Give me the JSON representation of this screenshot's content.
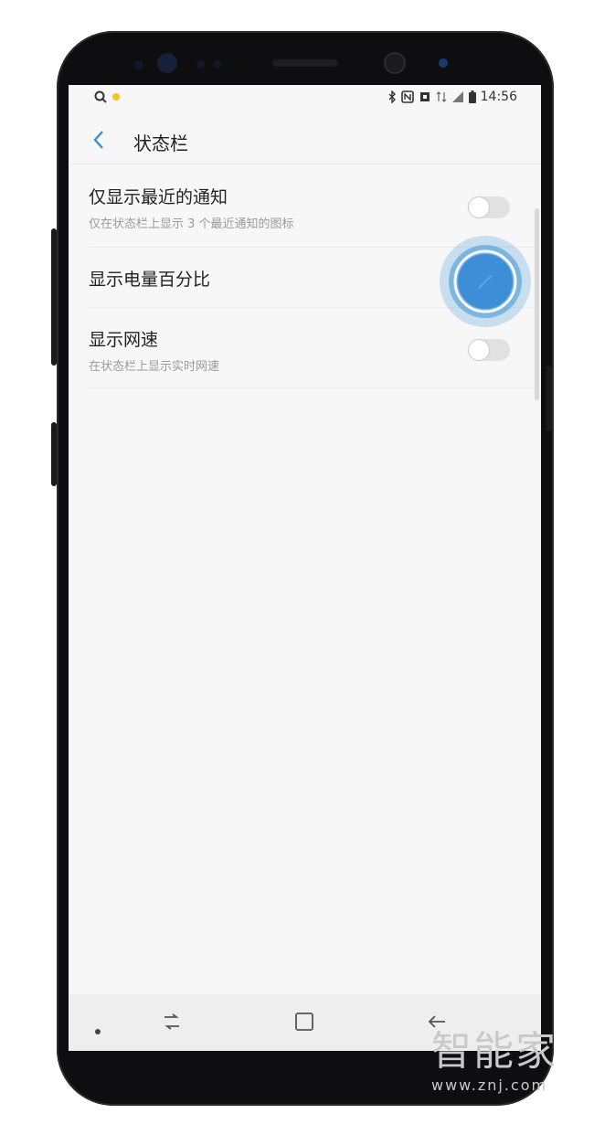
{
  "status_bar": {
    "time": "14:56",
    "left_icons": [
      "search-icon",
      "notification-dot-icon"
    ],
    "right_icons": [
      "bluetooth-icon",
      "nfc-icon",
      "vibrate-icon",
      "data-icon",
      "signal-icon",
      "battery-icon"
    ]
  },
  "header": {
    "back_icon": "chevron-left-icon",
    "title": "状态栏"
  },
  "settings": [
    {
      "title": "仅显示最近的通知",
      "subtitle": "仅在状态栏上显示 3 个最近通知的图标",
      "toggle_on": false
    },
    {
      "title": "显示电量百分比",
      "subtitle": "",
      "toggle_on": true
    },
    {
      "title": "显示网速",
      "subtitle": "在状态栏上显示实时网速",
      "toggle_on": false
    }
  ],
  "nav_bar": {
    "items": [
      "dot-icon",
      "recents-icon",
      "home-icon",
      "back-icon"
    ]
  },
  "watermark": {
    "text": "智能家",
    "url": "www.znj.com"
  },
  "colors": {
    "accent": "#3a8fd0",
    "touch_indicator": "#3c95d2",
    "screen_bg": "#f7f7f7"
  }
}
